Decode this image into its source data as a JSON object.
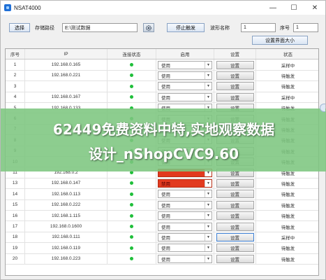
{
  "window": {
    "title": "NSAT4000",
    "minimize_glyph": "—",
    "maximize_glyph": "☐",
    "close_glyph": "✕"
  },
  "toolbar": {
    "choose_button": "选择",
    "save_path_label": "存储路径",
    "save_path_value": "E:\\测试数据",
    "gear_icon": "gear-icon",
    "stop_trigger_button": "停止触发",
    "waveform_name_label": "波形名称",
    "waveform_name_value": "1",
    "sequence_label": "序号",
    "sequence_value": "1",
    "set_ui_size_button": "设置界面大小"
  },
  "table": {
    "headers": [
      "序号",
      "IP",
      "连接状态",
      "启用",
      "设置",
      "状态"
    ],
    "rows": [
      {
        "no": "1",
        "ip": "192.168.0.165",
        "enable": "使用",
        "set": "设置",
        "status": "采样中"
      },
      {
        "no": "2",
        "ip": "192.168.0.221",
        "enable": "使用",
        "set": "设置",
        "status": "待触发"
      },
      {
        "no": "3",
        "ip": "",
        "enable": "使用",
        "set": "设置",
        "status": "待触发"
      },
      {
        "no": "4",
        "ip": "192.168.0.167",
        "enable": "使用",
        "set": "设置",
        "status": "采样中"
      },
      {
        "no": "5",
        "ip": "192.168.0.133",
        "enable": "使用",
        "set": "设置",
        "status": "待触发"
      },
      {
        "no": "6",
        "ip": "",
        "enable": "使用",
        "set": "设置",
        "status": "待触发"
      },
      {
        "no": "7",
        "ip": "",
        "enable": "使用",
        "set": "设置",
        "status": "待触发"
      },
      {
        "no": "8",
        "ip": "",
        "enable": "使用",
        "set": "设置",
        "status": "待触发"
      },
      {
        "no": "9",
        "ip": "",
        "enable": "使用",
        "set": "设置",
        "status": "待触发"
      },
      {
        "no": "10",
        "ip": "",
        "enable": "使用",
        "set": "设置",
        "status": "待触发"
      },
      {
        "no": "11",
        "ip": "192.168.0.2",
        "enable": "",
        "set": "设置",
        "status": "待触发"
      },
      {
        "no": "13",
        "ip": "192.168.0.147",
        "enable": "禁用",
        "set": "设置",
        "status": "待触发"
      },
      {
        "no": "14",
        "ip": "192.168.0.113",
        "enable": "使用",
        "set": "设置",
        "status": "待触发"
      },
      {
        "no": "15",
        "ip": "192.168.0.222",
        "enable": "使用",
        "set": "设置",
        "status": "待触发"
      },
      {
        "no": "16",
        "ip": "192.168.1.115",
        "enable": "使用",
        "set": "设置",
        "status": "待触发"
      },
      {
        "no": "17",
        "ip": "192.168.0.1600",
        "enable": "使用",
        "set": "设置",
        "status": "待触发"
      },
      {
        "no": "18",
        "ip": "192.168.0.111",
        "enable": "使用",
        "set": "设置",
        "status": "采样中"
      },
      {
        "no": "19",
        "ip": "192.168.0.119",
        "enable": "使用",
        "set": "设置",
        "status": "待触发"
      },
      {
        "no": "20",
        "ip": "192.168.0.223",
        "enable": "使用",
        "set": "设置",
        "status": "待触发"
      }
    ]
  },
  "banner": {
    "line1": "62449免费资料中特,实地观察数据",
    "line2": "设计_nShopCVC9.60"
  },
  "colors": {
    "connected": "#1fbf3a",
    "disabled_alert": "#e23a1f",
    "banner": "#7dc680"
  }
}
